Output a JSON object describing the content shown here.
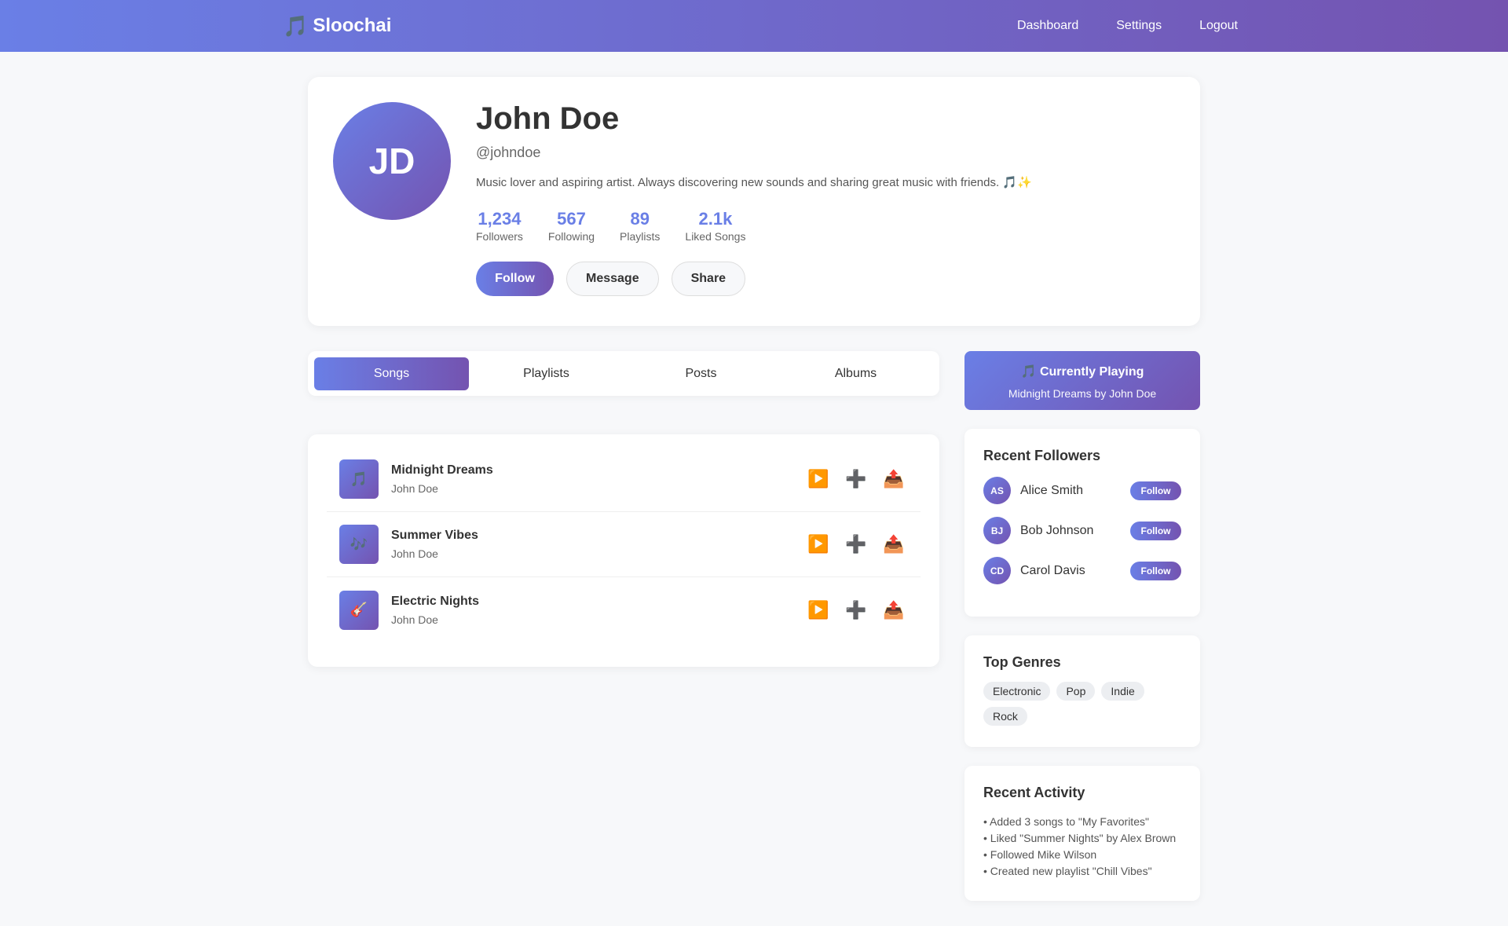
{
  "app": {
    "brand_icon": "🎵",
    "brand_name": "Sloochai",
    "nav": [
      "Dashboard",
      "Settings",
      "Logout"
    ]
  },
  "profile": {
    "initials": "JD",
    "name": "John Doe",
    "handle": "@johndoe",
    "bio": "Music lover and aspiring artist. Always discovering new sounds and sharing great music with friends. 🎵✨",
    "stats": [
      {
        "value": "1,234",
        "label": "Followers"
      },
      {
        "value": "567",
        "label": "Following"
      },
      {
        "value": "89",
        "label": "Playlists"
      },
      {
        "value": "2.1k",
        "label": "Liked Songs"
      }
    ],
    "actions": {
      "follow": "Follow",
      "message": "Message",
      "share": "Share"
    }
  },
  "tabs": [
    "Songs",
    "Playlists",
    "Posts",
    "Albums"
  ],
  "active_tab": "Songs",
  "songs": [
    {
      "icon": "🎵",
      "title": "Midnight Dreams",
      "artist": "John Doe"
    },
    {
      "icon": "🎶",
      "title": "Summer Vibes",
      "artist": "John Doe"
    },
    {
      "icon": "🎸",
      "title": "Electric Nights",
      "artist": "John Doe"
    }
  ],
  "song_actions": {
    "play": "▶️",
    "add": "➕",
    "share": "📤"
  },
  "now_playing": {
    "title": "🎵 Currently Playing",
    "subtitle": "Midnight Dreams by John Doe"
  },
  "recent_followers": {
    "title": "Recent Followers",
    "button_label": "Follow",
    "items": [
      {
        "initials": "AS",
        "name": "Alice Smith"
      },
      {
        "initials": "BJ",
        "name": "Bob Johnson"
      },
      {
        "initials": "CD",
        "name": "Carol Davis"
      }
    ]
  },
  "top_genres": {
    "title": "Top Genres",
    "items": [
      "Electronic",
      "Pop",
      "Indie",
      "Rock"
    ]
  },
  "recent_activity": {
    "title": "Recent Activity",
    "items": [
      "• Added 3 songs to \"My Favorites\"",
      "• Liked \"Summer Nights\" by Alex Brown",
      "• Followed Mike Wilson",
      "• Created new playlist \"Chill Vibes\""
    ]
  }
}
